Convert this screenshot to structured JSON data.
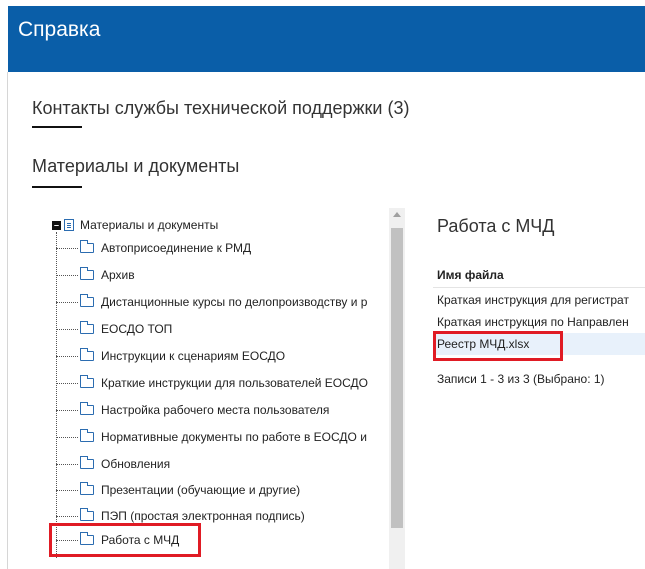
{
  "header": {
    "title": "Справка"
  },
  "sections": {
    "contacts_title": "Контакты службы технической поддержки (3)",
    "materials_title": "Материалы и документы"
  },
  "tree": {
    "root_label": "Материалы и документы",
    "items": [
      "Автоприсоединение к РМД",
      "Архив",
      "Дистанционные курсы по делопроизводству и р",
      "ЕОСДО ТОП",
      "Инструкции к сценариям ЕОСДО",
      "Краткие инструкции для пользователей ЕОСДО",
      "Настройка рабочего места пользователя",
      "Нормативные документы по работе в ЕОСДО и",
      "Обновления",
      "Презентации (обучающие и другие)",
      "ПЭП (простая электронная подпись)",
      "Работа с МЧД"
    ]
  },
  "right_panel": {
    "title": "Работа с МЧД",
    "column_header": "Имя файла",
    "rows": [
      "Краткая инструкция для регистрат",
      "Краткая инструкция по Направлен",
      "Реестр МЧД.xlsx"
    ],
    "footer": "Записи 1 - 3 из 3 (Выбрано: 1)"
  },
  "colors": {
    "header_bg": "#0a5ea8",
    "highlight": "#e01b24",
    "selected_row": "#e8f1fb"
  },
  "icons": {
    "folder": "folder-icon",
    "document": "document-icon",
    "collapse": "minus-box-icon"
  }
}
